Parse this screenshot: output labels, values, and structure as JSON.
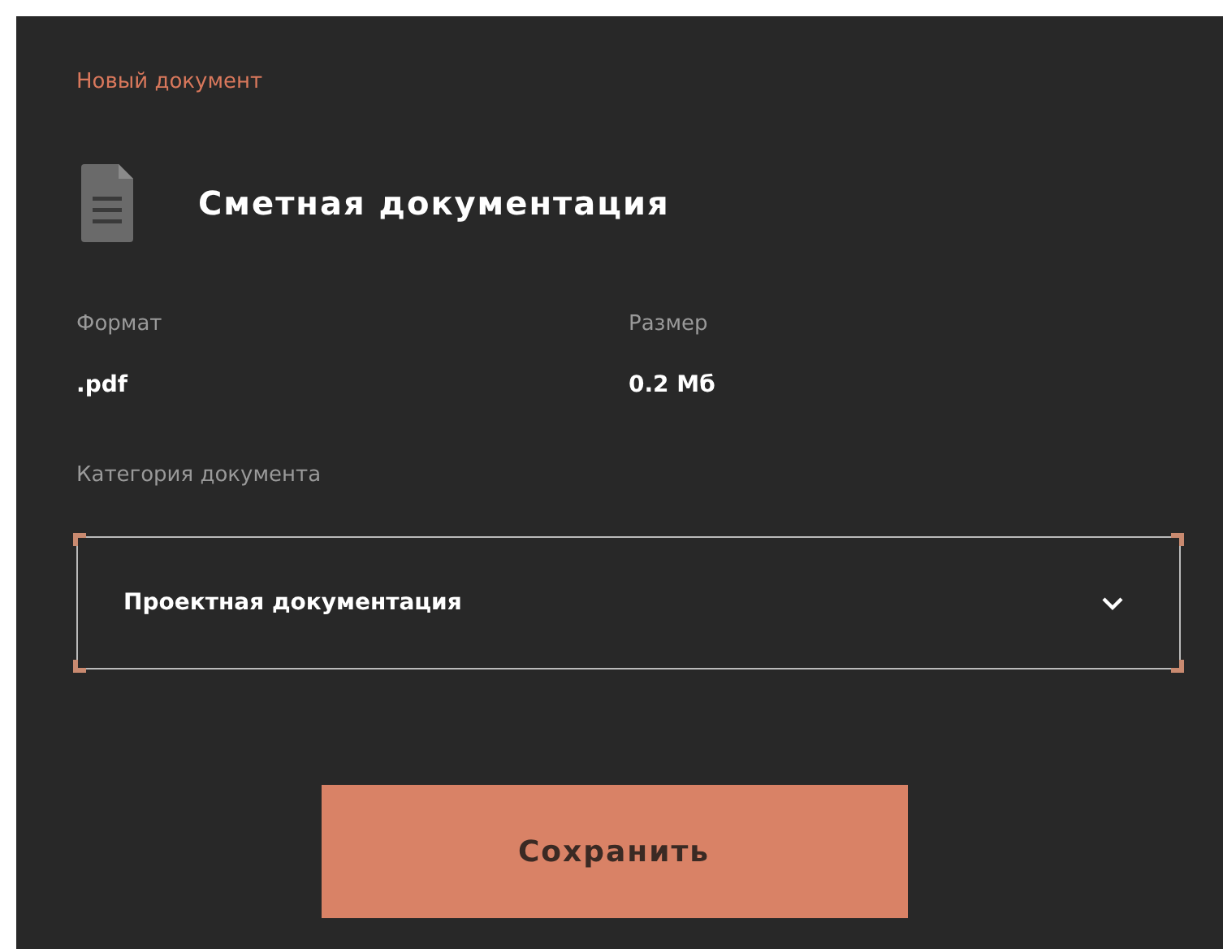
{
  "header": {
    "caption": "Новый документ",
    "title": "Сметная документация"
  },
  "fields": [
    {
      "label": "Формат",
      "value": ".pdf"
    },
    {
      "label": "Размер",
      "value": "0.2 Мб"
    }
  ],
  "category": {
    "label": "Категория документа",
    "value": "Проектная документация"
  },
  "buttons": [
    "Сохранить"
  ]
}
